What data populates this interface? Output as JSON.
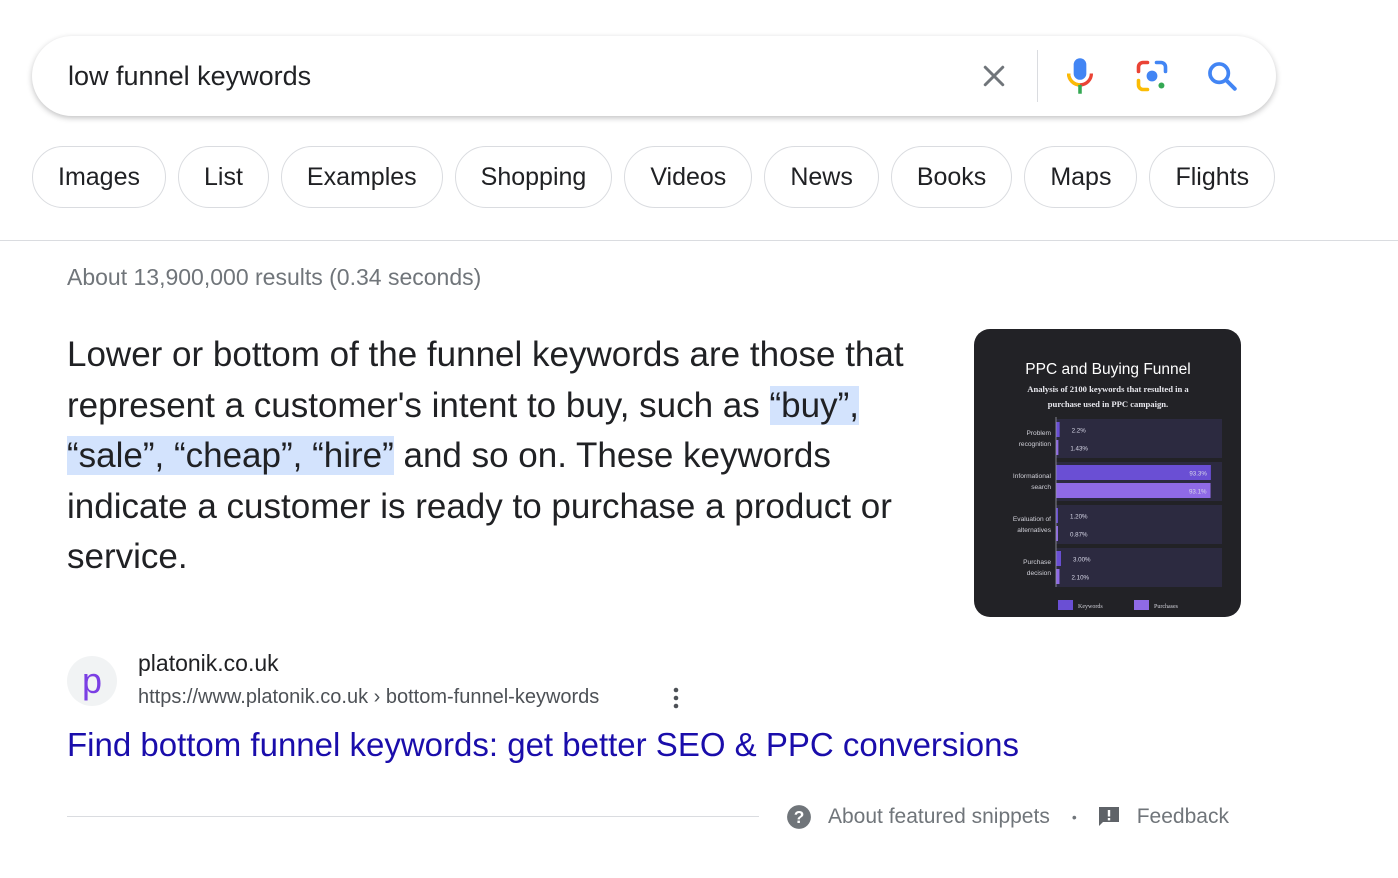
{
  "search": {
    "query": "low funnel keywords",
    "icons": [
      "close-icon",
      "microphone-icon",
      "lens-icon",
      "search-icon"
    ]
  },
  "chips": [
    "Images",
    "List",
    "Examples",
    "Shopping",
    "Videos",
    "News",
    "Books",
    "Maps",
    "Flights"
  ],
  "result_stats": "About 13,900,000 results (0.34 seconds)",
  "snippet": {
    "text_before": "Lower or bottom of the funnel keywords are those that represent a customer's intent to buy, such as ",
    "highlight": "“buy”, “sale”, “cheap”, “hire”",
    "text_after": " and so on. These keywords indicate a customer is ready to purchase a product or service."
  },
  "snippet_image": {
    "title": "PPC and Buying Funnel",
    "subtitle_line1": "Analysis of 2100 keywords that resulted in a",
    "subtitle_line2": "purchase used in PPC campaign.",
    "chart_data": {
      "type": "bar",
      "orientation": "horizontal",
      "categories": [
        "Problem recognition",
        "Informational search",
        "Evaluation of alternatives",
        "Purchase decision"
      ],
      "category_lines": [
        [
          "Problem",
          "recognition"
        ],
        [
          "Informational",
          "search"
        ],
        [
          "Evaluation of",
          "alternatives"
        ],
        [
          "Purchase",
          "decision"
        ]
      ],
      "series": [
        {
          "name": "Keywords",
          "values": [
            2.2,
            93.3,
            1.2,
            3.0
          ],
          "labels": [
            "2.2%",
            "93.3%",
            "1.20%",
            "3.00%"
          ]
        },
        {
          "name": "Purchases",
          "values": [
            1.43,
            93.1,
            0.87,
            2.1
          ],
          "labels": [
            "1.43%",
            "93.1%",
            "0.87%",
            "2.10%"
          ]
        }
      ],
      "legend": "bottom",
      "xlim": [
        0,
        100
      ]
    },
    "colors": {
      "keywords": "#6a4fd4",
      "purchases": "#8f6ae6",
      "band": "#2c2a40",
      "background": "#222226"
    }
  },
  "source": {
    "favicon_letter": "p",
    "site_name": "platonik.co.uk",
    "url": "https://www.platonik.co.uk › bottom-funnel-keywords",
    "title": "Find bottom funnel keywords: get better SEO & PPC conversions"
  },
  "footer": {
    "about": "About featured snippets",
    "separator": "•",
    "feedback": "Feedback"
  },
  "colors": {
    "link": "#1a0dab",
    "highlight": "#d3e3fd",
    "muted": "#70757a"
  }
}
